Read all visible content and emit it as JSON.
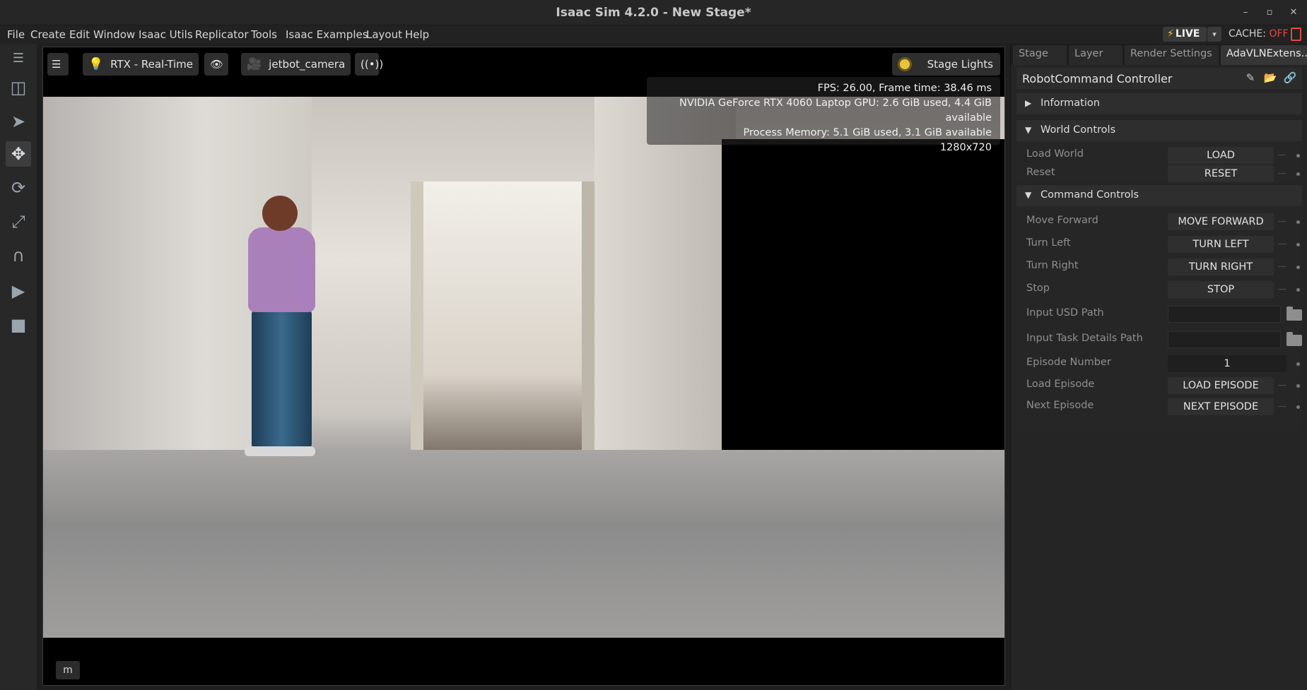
{
  "window": {
    "title": "Isaac Sim 4.2.0 - New Stage*",
    "controls": {
      "minimize": "–",
      "restore": "▫",
      "close": "✕"
    }
  },
  "menu": {
    "items": [
      "File",
      "Create",
      "Edit",
      "Window",
      "Isaac Utils",
      "Replicator",
      "Tools",
      "Isaac Examples",
      "Layout",
      "Help"
    ],
    "live_label": "LIVE",
    "live_dropdown": "▾",
    "cache_label": "CACHE:",
    "cache_state": "OFF"
  },
  "viewport": {
    "render_mode": "RTX - Real-Time",
    "camera": "jetbot_camera",
    "stage_lights": "Stage Lights",
    "stats": {
      "fps_line": "FPS: 26.00, Frame time: 38.46 ms",
      "gpu_line": "NVIDIA GeForce RTX 4060 Laptop GPU: 2.6 GiB used, 4.4 GiB available",
      "memory_line": "Process Memory: 5.1 GiB used, 3.1 GiB available",
      "resolution": "1280x720"
    },
    "bottom_button": "m"
  },
  "right_panel": {
    "tabs": [
      "Stage",
      "Layer",
      "Render Settings",
      "AdaVLNExtens..."
    ],
    "active_tab": "AdaVLNExtens...",
    "header_title": "RobotCommand Controller",
    "sections": {
      "information": {
        "title": "Information",
        "expanded": false
      },
      "world_controls": {
        "title": "World Controls",
        "rows": [
          {
            "label": "Load World",
            "button": "LOAD"
          },
          {
            "label": "Reset",
            "button": "RESET"
          }
        ]
      },
      "command_controls": {
        "title": "Command Controls",
        "rows": [
          {
            "label": "Move Forward",
            "button": "MOVE FORWARD"
          },
          {
            "label": "Turn Left",
            "button": "TURN LEFT"
          },
          {
            "label": "Turn Right",
            "button": "TURN RIGHT"
          },
          {
            "label": "Stop",
            "button": "STOP"
          }
        ],
        "input_usd_path": {
          "label": "Input USD Path",
          "value": ""
        },
        "input_task_path": {
          "label": "Input Task Details Path",
          "value": ""
        },
        "episode_number": {
          "label": "Episode Number",
          "value": "1"
        },
        "load_episode": {
          "label": "Load Episode",
          "button": "LOAD EPISODE"
        },
        "next_episode": {
          "label": "Next Episode",
          "button": "NEXT EPISODE"
        }
      }
    }
  },
  "icons": {
    "toolbar": [
      "hamburger-icon",
      "cube-icon",
      "select-arrow-icon",
      "move-icon",
      "rotate-icon",
      "scale-icon",
      "snap-magnet-icon",
      "play-icon",
      "stop-icon"
    ],
    "accent_color": "#f4c330",
    "cache_off_color": "#e24a3f"
  }
}
